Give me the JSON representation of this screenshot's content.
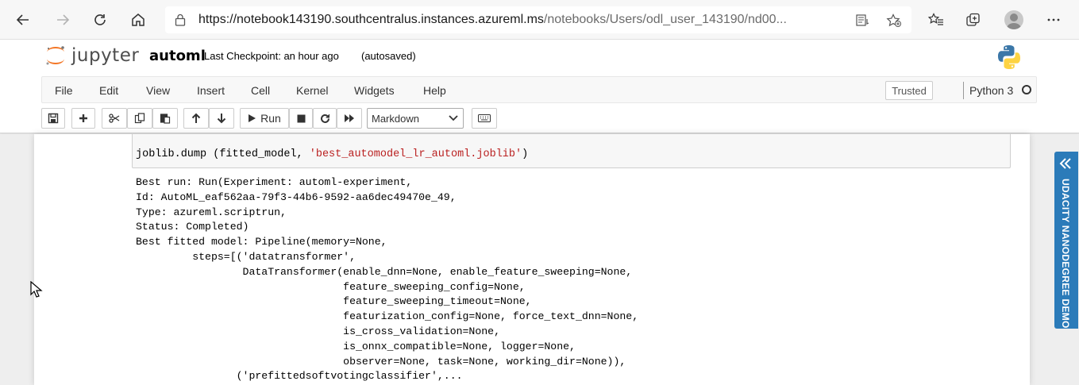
{
  "browser": {
    "url_main": "https://notebook143190.southcentralus.instances.azureml.ms",
    "url_rest": "/notebooks/Users/odl_user_143190/nd00..."
  },
  "jupyter": {
    "logo_text": "jupyter",
    "notebook_name": "automl",
    "checkpoint": "Last Checkpoint: an hour ago",
    "autosave": "(autosaved)",
    "menu": [
      "File",
      "Edit",
      "View",
      "Insert",
      "Cell",
      "Kernel",
      "Widgets",
      "Help"
    ],
    "trusted": "Trusted",
    "kernel": "Python 3",
    "run_label": "Run",
    "cell_type": "Markdown"
  },
  "cell": {
    "code_prefix": "joblib.dump (fitted_model, ",
    "code_string": "'best_automodel_lr_automl.joblib'",
    "code_suffix": ")",
    "output_lines": [
      "Best run: Run(Experiment: automl-experiment,",
      "Id: AutoML_eaf562aa-79f3-44b6-9592-aa6dec49470e_49,",
      "Type: azureml.scriptrun,",
      "Status: Completed)",
      "Best fitted model: Pipeline(memory=None,",
      "         steps=[('datatransformer',",
      "                 DataTransformer(enable_dnn=None, enable_feature_sweeping=None,",
      "                                 feature_sweeping_config=None,",
      "                                 feature_sweeping_timeout=None,",
      "                                 featurization_config=None, force_text_dnn=None,",
      "                                 is_cross_validation=None,",
      "                                 is_onnx_compatible=None, logger=None,",
      "                                 observer=None, task=None, working_dir=None)),",
      "                ('prefittedsoftvotingclassifier',..."
    ]
  },
  "side_panel": {
    "label": "UDACITY NANODEGREE DEMO",
    "color": "#2b7bb9"
  }
}
